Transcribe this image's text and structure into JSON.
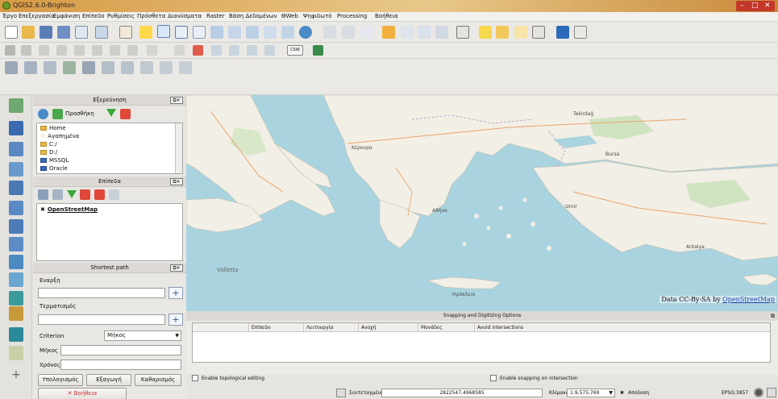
{
  "window": {
    "title": "QGIS2.6.0-Brighton"
  },
  "menu": [
    "Έργο",
    "Επεξεργασία",
    "Εμφάνιση",
    "Επίπεδο",
    "Ρυθμίσεις",
    "Πρόσθετα",
    "Διανύσματα",
    "Raster",
    "Βάση Δεδομένων",
    "ΘWeb",
    "Ψηφιδωτό",
    "Processing",
    "Βοήθεια"
  ],
  "toolbar2": {
    "csw_label": "CSW"
  },
  "browser_panel": {
    "title": "Εξερεύνηση",
    "refresh_label": "Προσθήκη",
    "items": [
      "Home",
      "Αγαπημένα",
      "C:/",
      "D:/",
      "MSSQL",
      "Oracle"
    ]
  },
  "layers_panel": {
    "title": "Επίπεδα",
    "layers": [
      "OpenStreetMap"
    ]
  },
  "shortest_path": {
    "title": "Shortest path",
    "start_label": "Εναρξη",
    "end_label": "Τερματισμός",
    "criterion_label": "Criterion",
    "criterion_value": "Μήκος",
    "length_label": "Μήκος",
    "time_label": "Χρόνος",
    "calc_button": "Υπολογισμός",
    "export_button": "Εξαγωγή",
    "clear_button": "Καθαρισμός",
    "help_button": "Βοήθεια"
  },
  "map": {
    "attribution_prefix": "Data CC-By-SA by ",
    "attribution_link": "OpenStreetMap",
    "labels": [
      "Tekirdağ",
      "Valletta",
      "Κέρκυρα",
      "Αθήνα",
      "Ηράκλειο",
      "Izmir",
      "Antalya",
      "Bursa"
    ]
  },
  "snapping": {
    "title": "Snapping and Digitizing Options",
    "columns": [
      "Επίπεδο",
      "Λειτουργία",
      "Ανοχή",
      "Μονάδες",
      "Avoid intersections"
    ],
    "topological_label": "Enable topological editing",
    "intersection_label": "Enable snapping on intersection"
  },
  "statusbar": {
    "coord_label": "Συντεταγμένη:",
    "coord_value": "2822547,4968585",
    "scale_label": "Κλίμακα",
    "scale_value": "1:9,575,769",
    "render_label": "Απόδοση",
    "crs": "EPSG:3857"
  }
}
